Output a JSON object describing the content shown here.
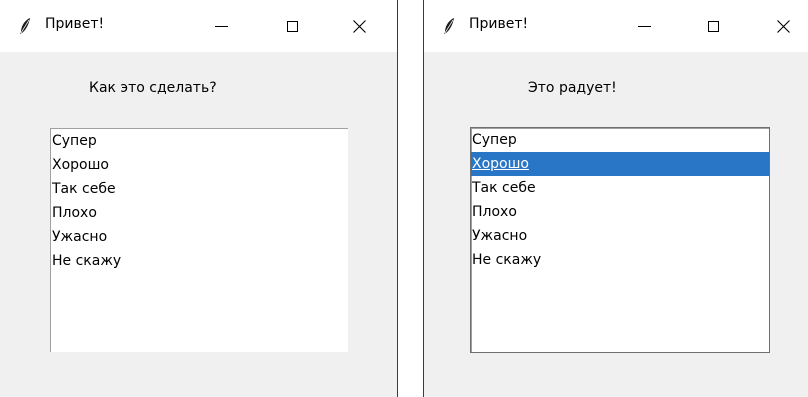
{
  "windows": [
    {
      "title": "Привет!",
      "label": "Как это сделать?",
      "items": [
        "Супер",
        "Хорошо",
        "Так себе",
        "Плохо",
        "Ужасно",
        "Не скажу"
      ],
      "selected_index": null
    },
    {
      "title": "Привет!",
      "label": "Это радует!",
      "items": [
        "Супер",
        "Хорошо",
        "Так себе",
        "Плохо",
        "Ужасно",
        "Не скажу"
      ],
      "selected_index": 1
    }
  ],
  "colors": {
    "selection_bg": "#2a76c6",
    "window_bg": "#f0f0f0",
    "titlebar_bg": "#ffffff"
  },
  "icons": {
    "app": "feather-icon",
    "minimize": "minimize-icon",
    "maximize": "maximize-icon",
    "close": "close-icon"
  }
}
